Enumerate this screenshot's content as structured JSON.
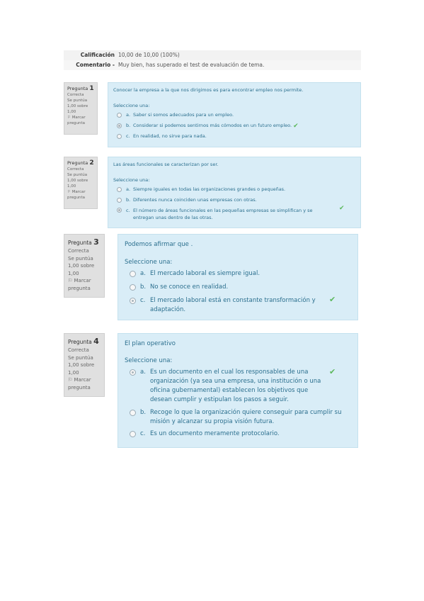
{
  "summary": {
    "grade_label": "Calificación",
    "grade_value": "10,00 de 10,00 (100%)",
    "comment_label": "Comentario -",
    "comment_value": "Muy bien, has superado el test de evaluación de tema."
  },
  "questions": [
    {
      "title_prefix": "Pregunta",
      "number": "1",
      "state": "Correcta",
      "grade": "Se puntúa 1,00 sobre 1,00",
      "flag_label": "Marcar pregunta",
      "text": "Conocer la empresa a la que nos dirigimos es para encontrar empleo nos permite.",
      "prompt": "Seleccione una:",
      "answers": [
        {
          "letter": "a.",
          "text": "Saber si somos adecuados para un empleo.",
          "selected": false
        },
        {
          "letter": "b.",
          "text": "Considerar si podemos sentirnos más cómodos en un futuro empleo.",
          "selected": true,
          "correct": true
        },
        {
          "letter": "c.",
          "text": "En realidad, no sirve para nada.",
          "selected": false
        }
      ]
    },
    {
      "title_prefix": "Pregunta",
      "number": "2",
      "state": "Correcta",
      "grade": "Se puntúa 1,00 sobre 1,00",
      "flag_label": "Marcar pregunta",
      "text": "Las áreas funcionales se caracterizan por ser.",
      "prompt": "Seleccione una:",
      "answers": [
        {
          "letter": "a.",
          "text": "Siempre iguales en todas las organizaciones grandes o pequeñas.",
          "selected": false
        },
        {
          "letter": "b.",
          "text": "Diferentes nunca coinciden unas empresas con otras.",
          "selected": false
        },
        {
          "letter": "c.",
          "text": "El número de áreas funcionales en las pequeñas empresas se simplifican y se entregan unas dentro de las otras.",
          "selected": true,
          "correct": true
        }
      ]
    },
    {
      "title_prefix": "Pregunta",
      "number": "3",
      "state": "Correcta",
      "grade": "Se puntúa 1,00 sobre 1,00",
      "flag_label": "Marcar pregunta",
      "text": "Podemos afirmar que .",
      "prompt": "Seleccione una:",
      "answers": [
        {
          "letter": "a.",
          "text": "El mercado laboral es siempre igual.",
          "selected": false
        },
        {
          "letter": "b.",
          "text": "No se conoce en realidad.",
          "selected": false
        },
        {
          "letter": "c.",
          "text": "El mercado laboral está en constante transformación y adaptación.",
          "selected": true,
          "correct": true
        }
      ]
    },
    {
      "title_prefix": "Pregunta",
      "number": "4",
      "state": "Correcta",
      "grade": "Se puntúa 1,00 sobre 1,00",
      "flag_label": "Marcar pregunta",
      "text": "El plan operativo",
      "prompt": "Seleccione una:",
      "answers": [
        {
          "letter": "a.",
          "text": "Es un documento en el cual los responsables de una organización (ya sea una empresa, una institución o una oficina gubernamental) establecen los objetivos que desean cumplir y estipulan los pasos a seguir.",
          "selected": true,
          "correct": true
        },
        {
          "letter": "b.",
          "text": "Recoge lo que la organización quiere conseguir para cumplir su misión y alcanzar su propia visión futura.",
          "selected": false
        },
        {
          "letter": "c.",
          "text": "Es un documento meramente protocolario.",
          "selected": false
        }
      ]
    }
  ],
  "icons": {
    "flag": "flag-icon",
    "check": "check-icon",
    "radio": "radio-icon"
  },
  "colors": {
    "content_bg": "#d9edf7",
    "info_bg": "#e0e0e0",
    "correct": "#5cb85c",
    "text": "#2b6f8e"
  }
}
